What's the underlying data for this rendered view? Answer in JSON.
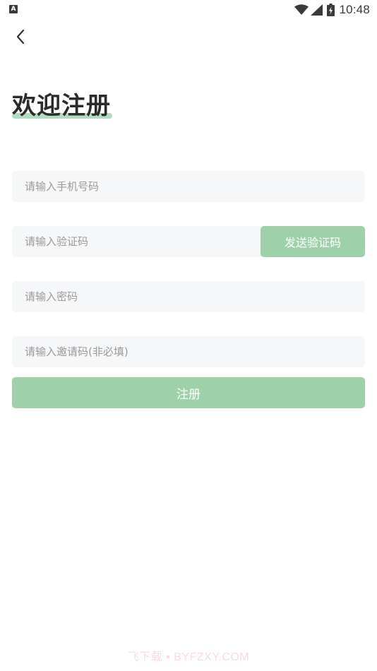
{
  "status_bar": {
    "notification_badge": "A",
    "time": "10:48",
    "icons": [
      "wifi-icon",
      "cell-signal-icon",
      "battery-charging-icon"
    ]
  },
  "nav": {
    "back_icon": "chevron-left-icon"
  },
  "page": {
    "title": "欢迎注册"
  },
  "form": {
    "phone_placeholder": "请输入手机号码",
    "phone_value": "",
    "code_placeholder": "请输入验证码",
    "code_value": "",
    "send_code_label": "发送验证码",
    "password_placeholder": "请输入密码",
    "password_value": "",
    "invite_placeholder": "请输入邀请码(非必填)",
    "invite_value": "",
    "register_label": "注册"
  },
  "watermark": "飞下载 • BYFZXY.COM",
  "colors": {
    "accent": "#9ed1a9",
    "title_underline": "#b4dbbf",
    "input_bg": "#f6f7f9",
    "placeholder": "#9a9a9a"
  }
}
